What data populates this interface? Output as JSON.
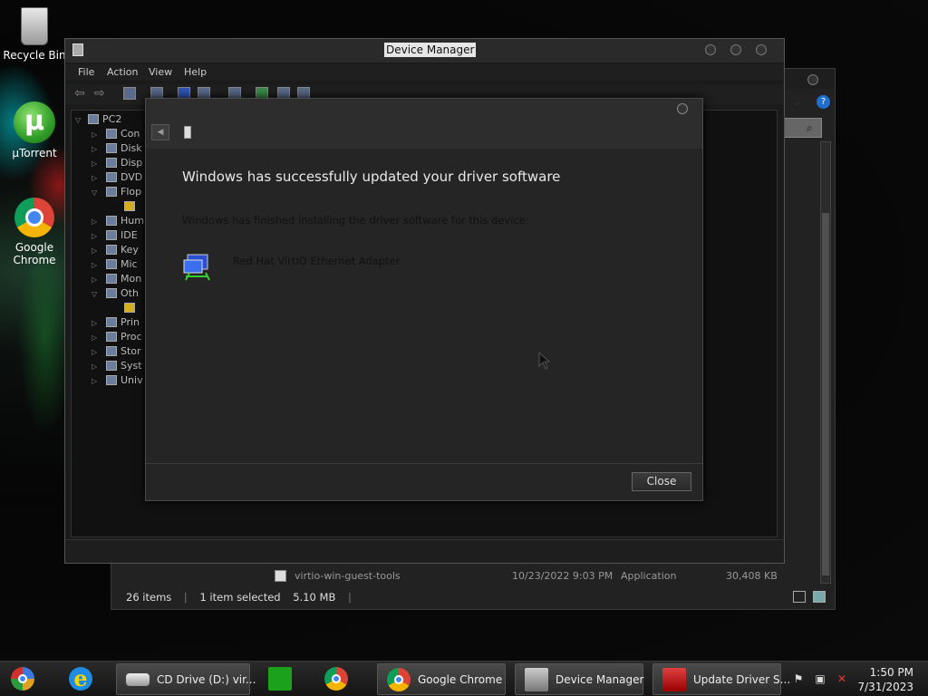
{
  "desktop": {
    "icons": [
      {
        "label": "Recycle Bin"
      },
      {
        "label": "µTorrent"
      },
      {
        "label": "Google Chrome"
      }
    ]
  },
  "explorer": {
    "file": {
      "name": "virtio-win-guest-tools",
      "date": "10/23/2022 9:03 PM",
      "type": "Application",
      "size": "30,408 KB"
    },
    "status": {
      "items": "26 items",
      "selected": "1 item selected",
      "size": "5.10 MB"
    }
  },
  "device_manager": {
    "title": "Device Manager",
    "menu": [
      "File",
      "Action",
      "View",
      "Help"
    ],
    "tree": {
      "root": "PC2",
      "items": [
        "Con",
        "Disk",
        "Disp",
        "DVD",
        "Flop",
        "Hum",
        "IDE",
        "Key",
        "Mic",
        "Mon",
        "Oth",
        "Prin",
        "Proc",
        "Stor",
        "Syst",
        "Univ"
      ]
    }
  },
  "dialog": {
    "heading": "Windows has successfully updated your driver software",
    "subtext": "Windows has finished installing the driver software for this device:",
    "device_name": "Red Hat VirtIO Ethernet Adapter",
    "close_label": "Close"
  },
  "taskbar": {
    "items": [
      {
        "label": "CD Drive (D:) vir..."
      },
      {
        "label": "Google Chrome"
      },
      {
        "label": "Device Manager"
      },
      {
        "label": "Update Driver S..."
      }
    ],
    "clock": {
      "time": "1:50 PM",
      "date": "7/31/2023"
    }
  }
}
